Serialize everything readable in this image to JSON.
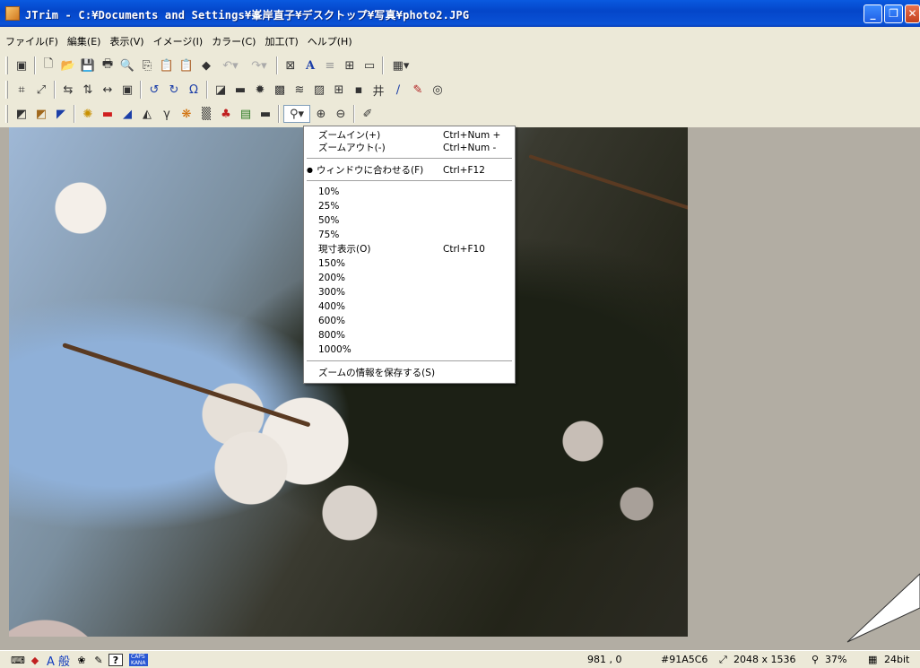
{
  "window": {
    "title": "JTrim - C:¥Documents and Settings¥峯岸直子¥デスクトップ¥写真¥photo2.JPG",
    "buttons": {
      "minimize": "_",
      "maximize": "❐",
      "close": "✕"
    }
  },
  "menubar": [
    "ファイル(F)",
    "編集(E)",
    "表示(V)",
    "イメージ(I)",
    "カラー(C)",
    "加工(T)",
    "ヘルプ(H)"
  ],
  "zoom_menu": {
    "items": [
      {
        "label": "ズームイン(+)",
        "shortcut": "Ctrl+Num +"
      },
      {
        "label": "ズームアウト(-)",
        "shortcut": "Ctrl+Num -"
      },
      {
        "label": "ウィンドウに合わせる(F)",
        "shortcut": "Ctrl+F12",
        "checked": true
      },
      {
        "label": "10%"
      },
      {
        "label": "25%"
      },
      {
        "label": "50%"
      },
      {
        "label": "75%"
      },
      {
        "label": "現寸表示(O)",
        "shortcut": "Ctrl+F10"
      },
      {
        "label": "150%"
      },
      {
        "label": "200%"
      },
      {
        "label": "300%"
      },
      {
        "label": "400%"
      },
      {
        "label": "600%"
      },
      {
        "label": "800%"
      },
      {
        "label": "1000%"
      },
      {
        "label": "ズームの情報を保存する(S)"
      }
    ],
    "bullet": "●"
  },
  "statusbar": {
    "coords": "981 , 0",
    "color": "#91A5C6",
    "dimensions": "2048 x 1536",
    "zoom": "37%",
    "depth": "24bit",
    "tray_ime": "A 般",
    "caps_top": "CAPS",
    "caps_bottom": "KANA"
  },
  "icons": {
    "toolbar1": [
      "properties-icon",
      "new-icon",
      "open-icon",
      "save-icon",
      "print-icon",
      "print-preview-icon",
      "copy-icon",
      "paste-icon",
      "paste-new-icon",
      "paint-icon",
      "undo-icon",
      "redo-icon",
      "fit-icon",
      "text-icon",
      "align-icon",
      "tile-icon",
      "frame-icon",
      "grid-dropdown-icon"
    ],
    "toolbar2": [
      "crop-icon",
      "resize-icon",
      "flip-h-icon",
      "flip-v-icon",
      "rotate-icon",
      "canvas-icon",
      "rotate-ccw-icon",
      "rotate-cw-icon",
      "rotate-free-icon",
      "shadow-icon",
      "border-icon",
      "star-icon",
      "mosaic-icon",
      "wave-icon",
      "emboss-icon",
      "blur-icon",
      "sharpen-icon",
      "pattern-icon",
      "pen-icon",
      "brush-icon",
      "spiral-icon"
    ],
    "toolbar3": [
      "gray-icon",
      "sepia-icon",
      "invert-icon",
      "sparkle-icon",
      "color-balance-icon",
      "palette-icon",
      "level-icon",
      "gamma-icon",
      "hue-icon",
      "noise-icon",
      "hdr-icon",
      "saturation-icon",
      "contrast-icon",
      "zoom-dropdown-icon",
      "zoom-in-icon",
      "zoom-out-icon",
      "eyedropper-icon"
    ]
  }
}
